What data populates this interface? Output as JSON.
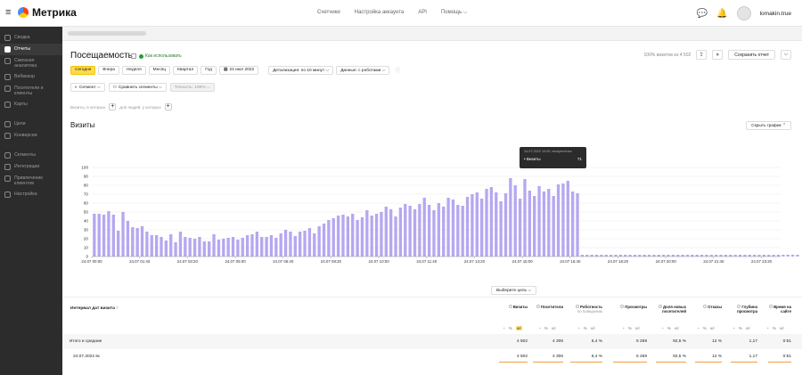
{
  "header": {
    "logo_text": "Метрика",
    "nav": [
      "Счетчики",
      "Настройка аккаунта",
      "API",
      "Помощь ⌵"
    ],
    "username": "lomakin.true"
  },
  "sidebar": {
    "items": [
      {
        "label": "Сводка",
        "icon": "home-icon",
        "active": false
      },
      {
        "label": "Отчеты",
        "icon": "bar-chart-icon",
        "active": true
      },
      {
        "label": "Сквозная аналитика",
        "icon": "link-icon",
        "active": false
      },
      {
        "label": "Вебвизор",
        "icon": "play-icon",
        "active": false
      },
      {
        "label": "Посетители и клиенты",
        "icon": "user-icon",
        "active": false
      },
      {
        "label": "Карты",
        "icon": "map-icon",
        "active": false
      },
      {
        "label": "Цели",
        "icon": "target-icon",
        "active": false
      },
      {
        "label": "Конверсии",
        "icon": "funnel-icon",
        "active": false
      },
      {
        "label": "Сегменты",
        "icon": "segments-icon",
        "active": false
      },
      {
        "label": "Интеграции",
        "icon": "puzzle-icon",
        "active": false
      },
      {
        "label": "Привлечение клиентов",
        "icon": "rocket-icon",
        "active": false
      },
      {
        "label": "Настройка",
        "icon": "gear-icon",
        "active": false
      }
    ]
  },
  "page": {
    "title": "Посещаемость",
    "howto": "Как использовать",
    "visits_share": "100% визитов из 4 502",
    "save_label": "Сохранить отчет",
    "periods": [
      "Сегодня",
      "Вчера",
      "Неделя",
      "Месяц",
      "Квартал",
      "Год"
    ],
    "active_period": "Сегодня",
    "date": "24 июл 2022",
    "detail": "Детализация: по 10 минут ⌵",
    "robots": "Данные: с роботами ⌵",
    "segment": "Сегмент ⌵",
    "compare": "Сравнить сегменты ⌵",
    "accuracy": "Точность: 100% ⌵",
    "filter_visits": "Визиты, в которых",
    "filter_people": "для людей, у которых",
    "chart_name": "Визиты",
    "hide_chart": "Скрыть график ⌃",
    "goal": "Выберите цель ⌵"
  },
  "tooltip": {
    "head": "24.07.2022 14:50, воскресенье",
    "label": "• Визиты",
    "value": "71"
  },
  "chart_data": {
    "type": "bar",
    "ylim": [
      0,
      100
    ],
    "yticks": [
      0,
      10,
      20,
      30,
      40,
      50,
      60,
      70,
      80,
      90,
      100
    ],
    "xtick_labels": [
      "24.07 00:00",
      "24.07 01:40",
      "24.07 03:20",
      "24.07 05:00",
      "24.07 06:40",
      "24.07 08:20",
      "24.07 10:00",
      "24.07 11:40",
      "24.07 13:20",
      "24.07 15:00",
      "24.07 16:40",
      "24.07 18:20",
      "24.07 20:00",
      "24.07 21:40",
      "24.07 23:20"
    ],
    "total_slots": 144,
    "color": "#b7a7f0",
    "values": [
      48,
      48,
      47,
      51,
      47,
      29,
      50,
      40,
      33,
      32,
      34,
      28,
      24,
      24,
      22,
      18,
      25,
      16,
      28,
      22,
      21,
      20,
      22,
      17,
      17,
      25,
      19,
      20,
      21,
      22,
      19,
      21,
      24,
      25,
      28,
      22,
      22,
      24,
      21,
      26,
      30,
      28,
      23,
      28,
      29,
      32,
      26,
      34,
      37,
      41,
      43,
      46,
      47,
      45,
      48,
      41,
      44,
      52,
      46,
      48,
      50,
      56,
      53,
      45,
      55,
      59,
      57,
      53,
      59,
      66,
      58,
      52,
      60,
      56,
      66,
      64,
      58,
      57,
      67,
      70,
      72,
      65,
      76,
      78,
      72,
      62,
      71,
      88,
      80,
      65,
      87,
      74,
      68,
      79,
      73,
      76,
      68,
      81,
      82,
      85,
      73,
      71,
      2,
      2,
      2,
      2,
      2,
      2,
      2,
      2,
      2,
      2,
      2,
      2,
      2,
      2,
      2,
      2,
      2,
      2,
      2,
      2,
      2,
      2,
      2,
      2,
      2,
      2,
      2,
      2,
      2,
      2,
      2,
      2,
      2,
      2,
      2,
      2,
      2,
      2,
      2,
      2,
      2,
      2,
      2,
      2,
      2,
      2
    ]
  },
  "table": {
    "group_header": "Интервал дат визита ↑",
    "columns": [
      {
        "name": "Визиты",
        "sub": ""
      },
      {
        "name": "Посетители",
        "sub": ""
      },
      {
        "name": "Роботность",
        "sub": "по поведению"
      },
      {
        "name": "Просмотры",
        "sub": ""
      },
      {
        "name": "Доля новых посетителей",
        "sub": ""
      },
      {
        "name": "Отказы",
        "sub": ""
      },
      {
        "name": "Глубина просмотра",
        "sub": ""
      },
      {
        "name": "Время на сайте",
        "sub": ""
      }
    ],
    "total_label": "Итого и средние",
    "total": [
      "4 502",
      "4 306",
      "6,4 %",
      "5 269",
      "92,5 %",
      "12 %",
      "1,17",
      "0:51"
    ],
    "row_label": "24.07.2022 вс",
    "row": [
      "4 502",
      "4 306",
      "6,4 %",
      "5 269",
      "92,5 %",
      "12 %",
      "1,17",
      "0:51"
    ],
    "mode_pct": "%",
    "mode_bar": "ıııl"
  }
}
